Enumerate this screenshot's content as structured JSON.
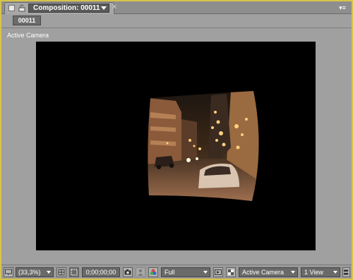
{
  "tab": {
    "title": "Composition: 00011"
  },
  "breadcrumb": {
    "label": "00011"
  },
  "viewer": {
    "label": "Active Camera"
  },
  "toolbar": {
    "magnification": "(33,3%)",
    "timecode": "0;00;00;00",
    "resolution": "Full",
    "view_camera": "Active Camera",
    "view_layout": "1 View"
  },
  "colors": {
    "frame_accent": "#d8c54a",
    "panel_bg": "#a0a0a0",
    "viewport_bg": "#000000"
  },
  "icons": [
    "composition-icon",
    "lock-icon",
    "tab-dropdown-icon",
    "close-icon",
    "panel-menu-icon",
    "monitor-icon",
    "grid-icon",
    "region-of-interest-icon",
    "camera-snapshot-icon",
    "show-snapshot-icon",
    "channel-rgb-icon",
    "fast-preview-icon",
    "transparency-grid-icon",
    "flowchart-icon"
  ]
}
